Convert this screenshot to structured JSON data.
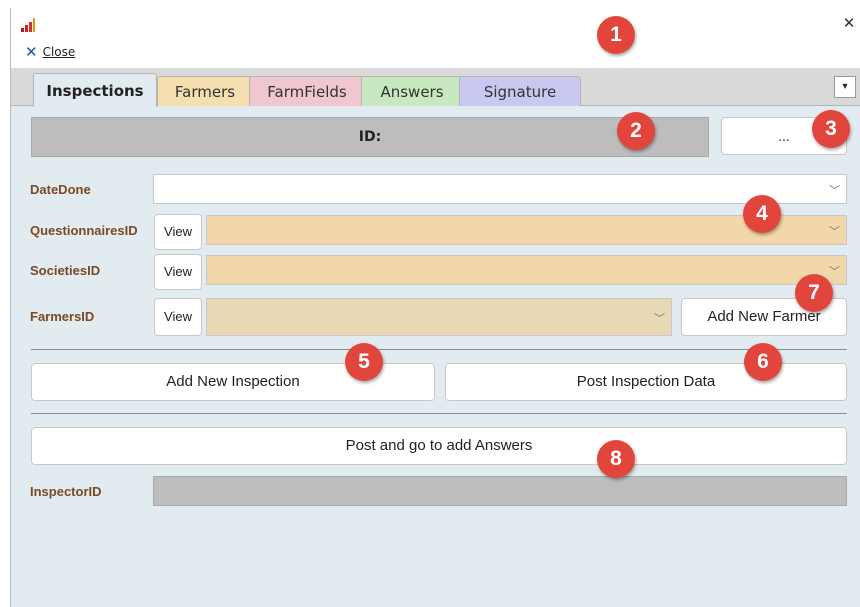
{
  "commandbar": {
    "close_label": "Close"
  },
  "tabs": [
    {
      "label": "Inspections"
    },
    {
      "label": "Farmers"
    },
    {
      "label": "FarmFields"
    },
    {
      "label": "Answers"
    },
    {
      "label": "Signature"
    }
  ],
  "form": {
    "id_label": "ID:",
    "dots_button": "...",
    "date_done_label": "DateDone",
    "questionnaires_label": "QuestionnairesID",
    "societies_label": "SocietiesID",
    "farmers_label": "FarmersID",
    "view_label": "View",
    "add_new_farmer": "Add New Farmer",
    "add_new_inspection": "Add New Inspection",
    "post_inspection_data": "Post Inspection Data",
    "post_and_go": "Post and go to add Answers",
    "inspector_label": "InspectorID"
  },
  "badges": [
    "1",
    "2",
    "3",
    "4",
    "5",
    "6",
    "7",
    "8"
  ],
  "colors": {
    "badge": "#e2453c",
    "panel": "#e2ebef",
    "label": "#7a4a25",
    "dropdown_tan": "#f1d7a9",
    "farmers_tab": "#f5deb0",
    "farmfields_tab": "#f1c7cf",
    "answers_tab": "#c8e9bf",
    "signature_tab": "#c9c8f1"
  }
}
